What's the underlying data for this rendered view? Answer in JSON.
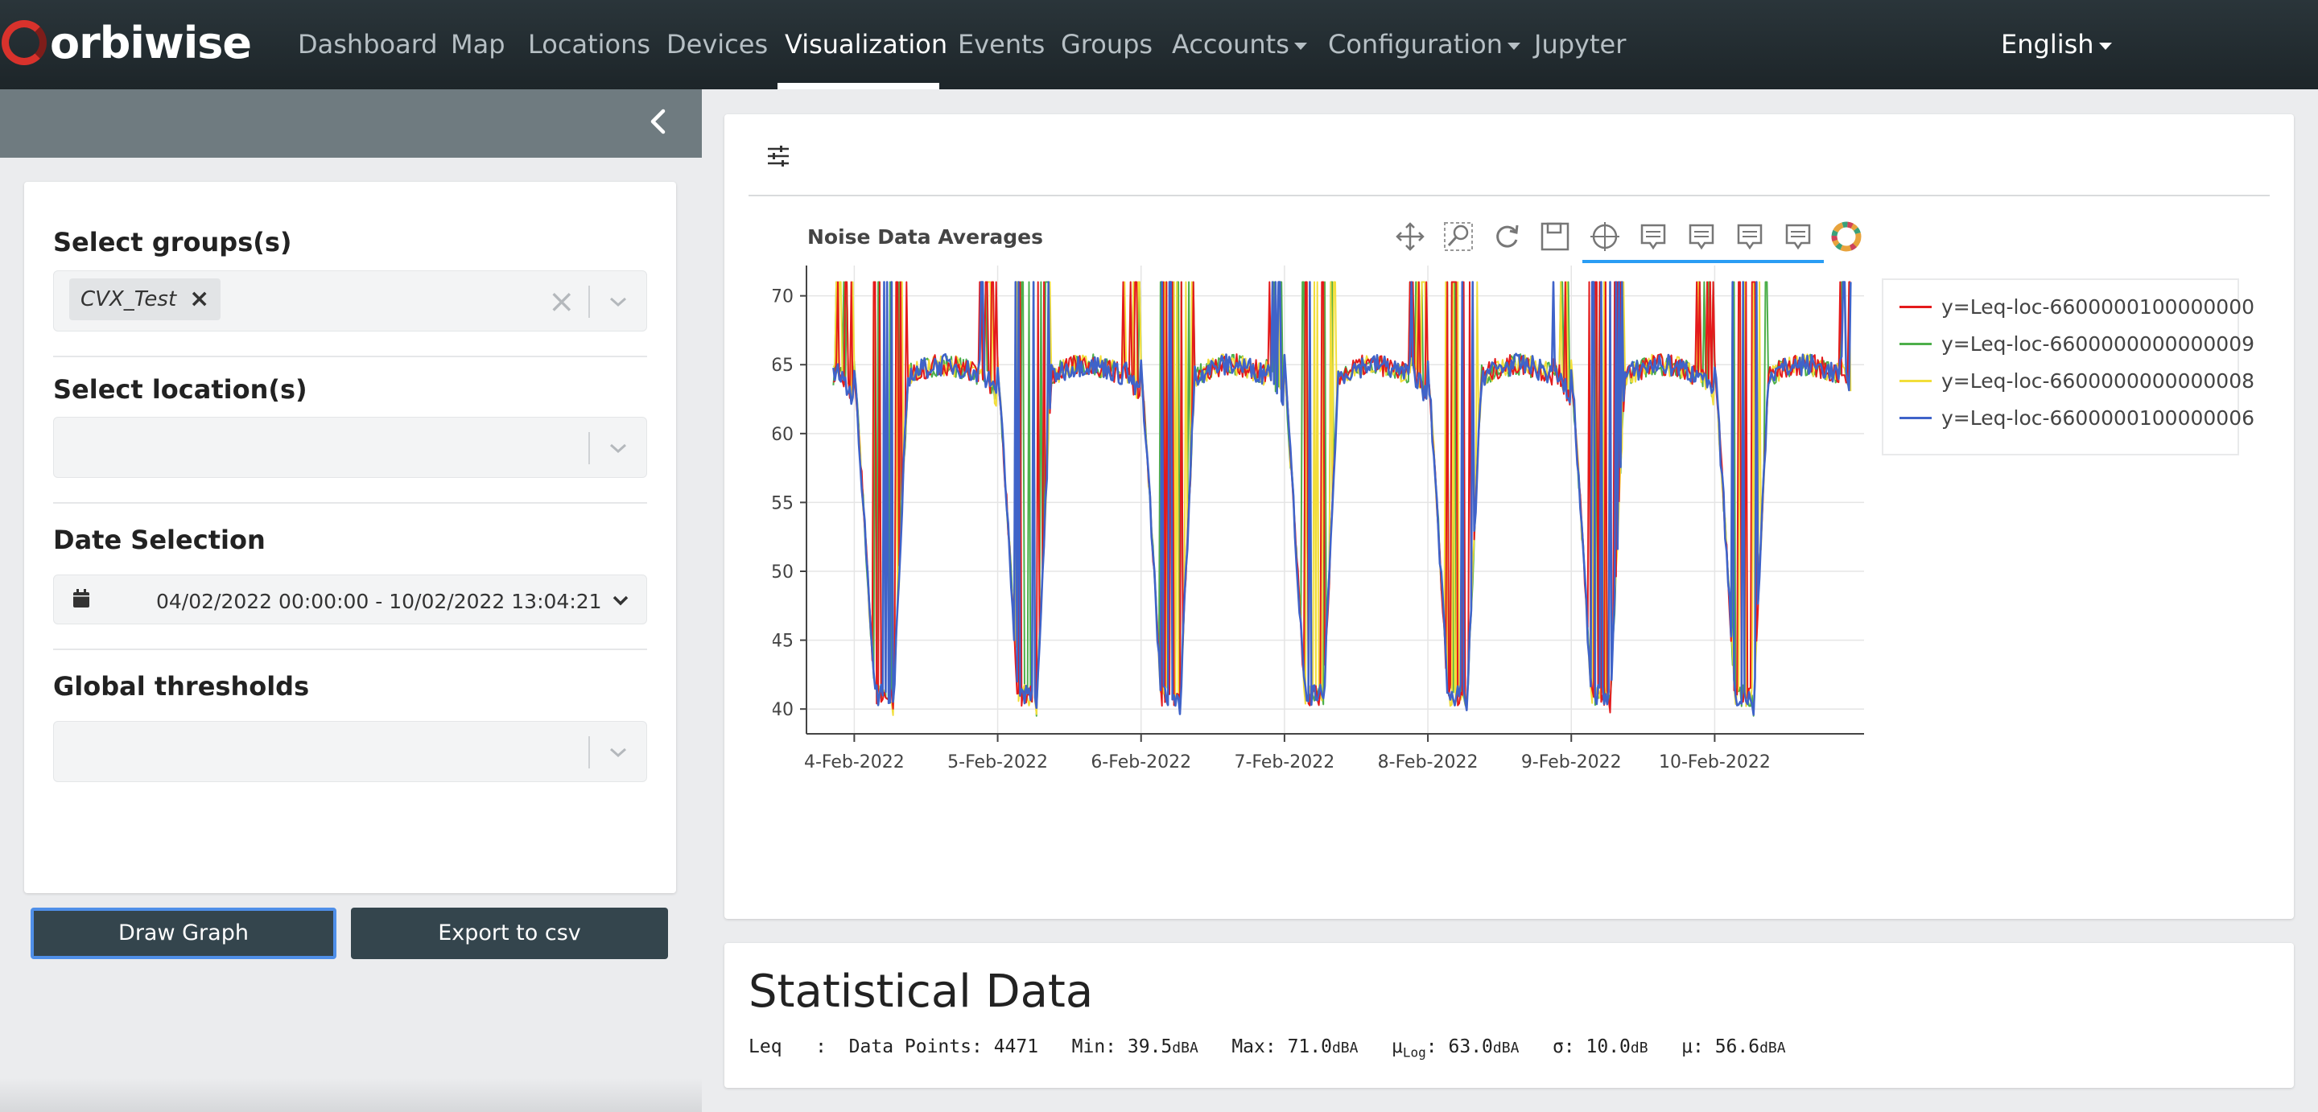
{
  "brand": {
    "name": "orbiwise"
  },
  "nav": {
    "items": [
      {
        "label": "Dashboard"
      },
      {
        "label": "Map"
      },
      {
        "label": "Locations"
      },
      {
        "label": "Devices"
      },
      {
        "label": "Visualization",
        "active": true
      },
      {
        "label": "Events"
      },
      {
        "label": "Groups"
      },
      {
        "label": "Accounts",
        "dropdown": true
      },
      {
        "label": "Configuration",
        "dropdown": true
      },
      {
        "label": "Jupyter"
      }
    ],
    "language": "English"
  },
  "sidebar": {
    "groups": {
      "label": "Select groups(s)",
      "selected_tag": "CVX_Test",
      "tag_remove": "×",
      "clear": "×"
    },
    "locations": {
      "label": "Select location(s)",
      "value": ""
    },
    "date": {
      "label": "Date Selection",
      "value": "04/02/2022 00:00:00 - 10/02/2022 13:04:21"
    },
    "thresholds": {
      "label": "Global thresholds",
      "value": ""
    },
    "draw_button": "Draw Graph",
    "export_button": "Export to csv"
  },
  "toolbar_icons": [
    "pan-icon",
    "box-zoom-icon",
    "reset-icon",
    "save-icon",
    "crosshair-icon",
    "hover-icon",
    "hover-icon",
    "hover-icon",
    "hover-icon",
    "bokeh-logo-icon"
  ],
  "chart_data": {
    "type": "line",
    "title": "Noise Data Averages",
    "xlabel": "",
    "ylabel": "",
    "x_tick_labels": [
      "4-Feb-2022",
      "5-Feb-2022",
      "6-Feb-2022",
      "7-Feb-2022",
      "8-Feb-2022",
      "9-Feb-2022",
      "10-Feb-2022"
    ],
    "xlim": [
      "2022-02-03 16:00",
      "2022-02-11 01:00"
    ],
    "y_ticks": [
      40,
      45,
      50,
      55,
      60,
      65,
      70
    ],
    "ylim": [
      38.2,
      72.2
    ],
    "grid": true,
    "legend_position": "outside-right",
    "series": [
      {
        "name": "y=Leq-loc-6600000100000000",
        "color": "#e41a1c"
      },
      {
        "name": "y=Leq-loc-6600000000000009",
        "color": "#4daf4a"
      },
      {
        "name": "y=Leq-loc-6600000000000008",
        "color": "#f2de3a"
      },
      {
        "name": "y=Leq-loc-6600000100000006",
        "color": "#3f63c9"
      }
    ],
    "pattern_description_values": {
      "x_start": "2022-02-03 20:30",
      "x_end": "2022-02-10 23:00",
      "daytime_plateau_dBA": 65,
      "night_trough_dBA": 40,
      "spike_peak_dBA": 71
    }
  },
  "stats": {
    "title": "Statistical Data",
    "metric": "Leq",
    "sep": ":",
    "data_points_label": "Data Points:",
    "data_points": "4471",
    "min_label": "Min:",
    "min": "39.5",
    "max_label": "Max:",
    "max": "71.0",
    "mulog_label": "μ",
    "mulog_sub": "Log",
    "mulog": "63.0",
    "sigma_label": "σ:",
    "sigma": "10.0",
    "mu_label": "μ:",
    "mu": "56.6",
    "unit_dba": "dBA",
    "unit_db": "dB"
  }
}
